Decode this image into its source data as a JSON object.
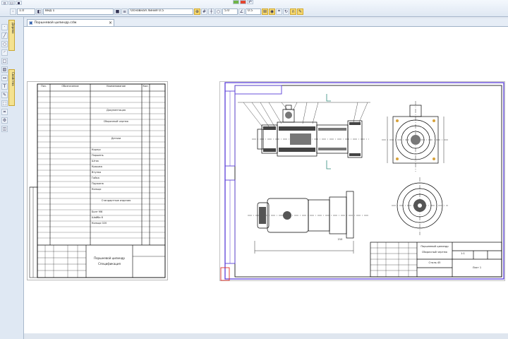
{
  "window": {
    "document_tab_title": "Поршневой цилиндр.cdw",
    "document_tab_close": "×"
  },
  "toolbar": {
    "scale_value": "1.0",
    "layer_value": "Вид 1",
    "style_value": "Основная линия 0.5",
    "step_value": "5.0",
    "zoom_value": "0.5"
  },
  "left_panel": {
    "tab_1": "Дерево",
    "tab_2": "Свойства"
  },
  "spec": {
    "headers": [
      "Поз.",
      "Обозначение",
      "Наименование",
      "Кол."
    ],
    "sections": [
      "Документация",
      "Сборочный чертеж",
      "Детали",
      "Стандартные изделия"
    ],
    "parts": [
      "Корпус",
      "Поршень",
      "Шток",
      "Крышка",
      "Втулка",
      "Гайка",
      "Пружина",
      "Кольцо"
    ],
    "standard": [
      "Болт М6",
      "Шайба 6",
      "Кольцо 020"
    ],
    "title": "Поршневой цилиндр",
    "subtitle": "Спецификация"
  },
  "drawing": {
    "title_line_1": "Поршневой цилиндр",
    "title_line_2": "Сборочный чертеж",
    "material": "Сталь 45",
    "sheet_label": "Лист 1",
    "scale": "1:1",
    "dimension_overall": "210"
  }
}
